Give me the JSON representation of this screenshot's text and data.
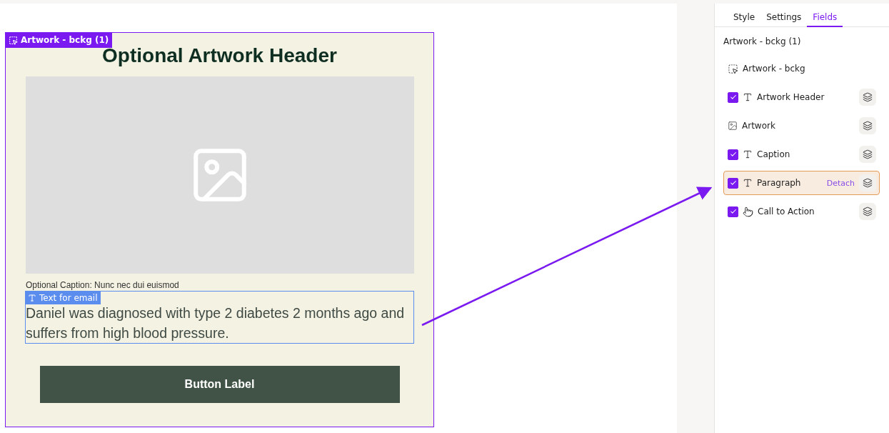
{
  "canvas": {
    "frame_badge": "Artwork - bckg (1)",
    "header": "Optional Artwork Header",
    "caption": "Optional Caption: Nunc nec dui euismod",
    "text_badge": "Text for email",
    "paragraph": "Daniel was diagnosed with type 2 diabetes 2 months ago and suffers from high blood pressure.",
    "button": "Button Label"
  },
  "tabs": [
    {
      "label": "Style",
      "selected": false
    },
    {
      "label": "Settings",
      "selected": false
    },
    {
      "label": "Fields",
      "selected": true
    }
  ],
  "panel_title": "Artwork - bckg (1)",
  "fields": [
    {
      "kind": "frame",
      "label": "Artwork - bckg",
      "selected": false
    },
    {
      "kind": "text",
      "label": "Artwork Header",
      "checked": true,
      "selected": false
    },
    {
      "kind": "image",
      "label": "Artwork",
      "selected": false
    },
    {
      "kind": "text",
      "label": "Caption",
      "checked": true,
      "selected": false
    },
    {
      "kind": "text",
      "label": "Paragraph",
      "checked": true,
      "selected": true,
      "action": "Detach"
    },
    {
      "kind": "action",
      "label": "Call to Action",
      "checked": true,
      "selected": false
    }
  ]
}
